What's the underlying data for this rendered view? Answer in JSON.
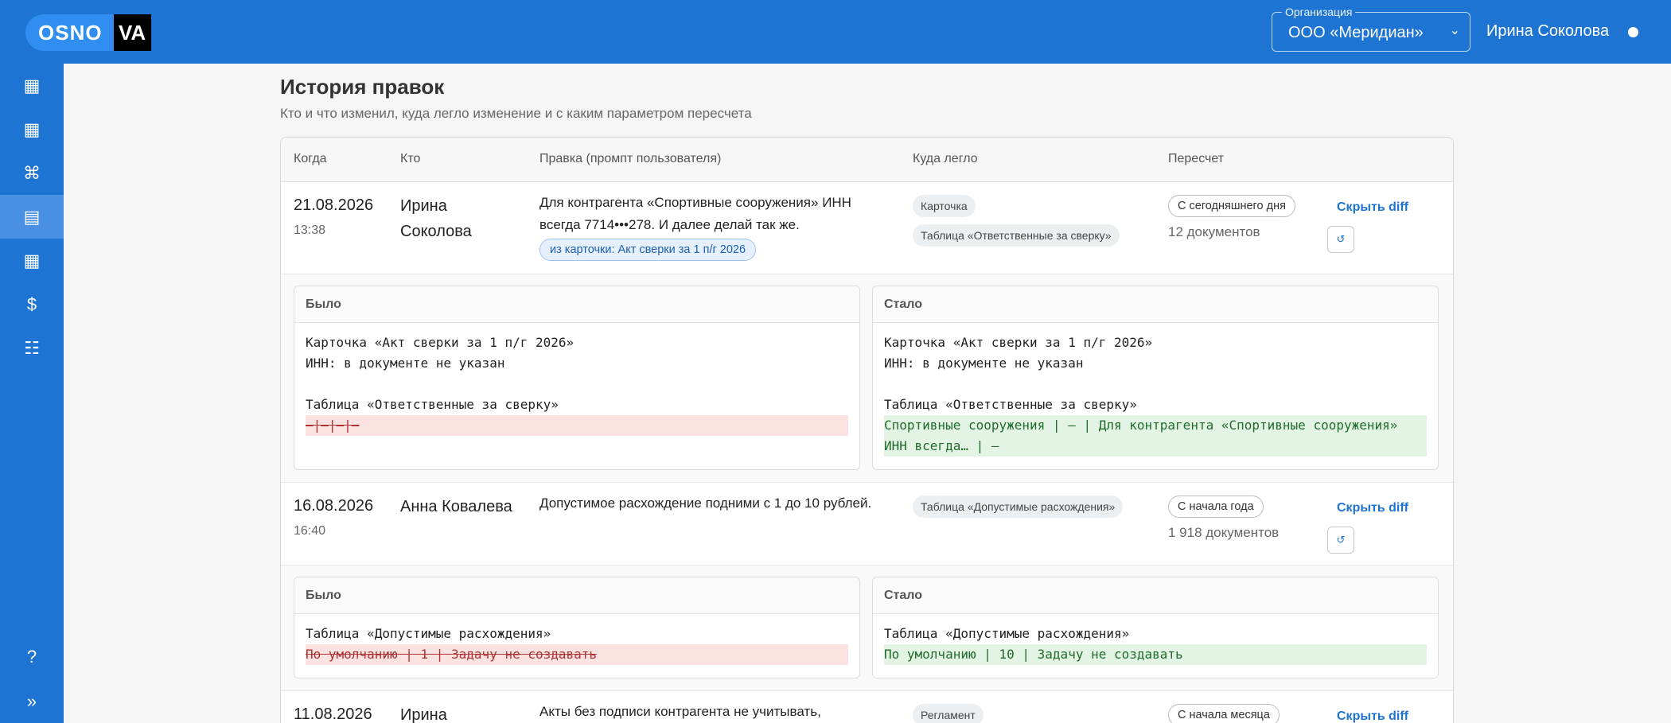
{
  "app": {
    "logo_left": "OSNO",
    "logo_right": "VA"
  },
  "header": {
    "org_label": "Организация",
    "org_value": "ООО «Меридиан»",
    "user_name": "Ирина Соколова"
  },
  "sidebar": {
    "items": [
      {
        "icon": "grid-icon",
        "glyph": "▦"
      },
      {
        "icon": "grid-icon",
        "glyph": "▦"
      },
      {
        "icon": "command-icon",
        "glyph": "⌘"
      },
      {
        "icon": "table-icon",
        "glyph": "▤"
      },
      {
        "icon": "grid-icon",
        "glyph": "▦"
      },
      {
        "icon": "dollar-icon",
        "glyph": "$"
      },
      {
        "icon": "list-icon",
        "glyph": "☷"
      }
    ],
    "help": "?",
    "expand": "»"
  },
  "page": {
    "title": "История правок",
    "subtitle": "Кто и что изменил, куда легло изменение и с каким параметром пересчета"
  },
  "table": {
    "headers": {
      "when": "Когда",
      "who": "Кто",
      "edit": "Правка (промпт пользователя)",
      "where": "Куда легло",
      "recalc": "Пересчет"
    },
    "rows": [
      {
        "date": "21.08.2026",
        "time": "13:38",
        "who": "Ирина Соколова",
        "edit": "Для контрагента «Спортивные сооружения» ИНН всегда 7714•••278. И далее делай так же.",
        "source": "из карточки: Акт сверки за 1 п/г 2026",
        "targets": [
          "Карточка",
          "Таблица «Ответственные за сверку»"
        ],
        "recalc": "С сегодняшнего дня",
        "docs": "12 документов",
        "toggle": "Скрыть diff",
        "recalc_btn": "↺",
        "was_label": "Было",
        "now_label": "Стало",
        "was_lines": [
          "Карточка «Акт сверки за 1 п/г 2026»",
          "ИНН: в документе не указан",
          "",
          "Таблица «Ответственные за сверку»"
        ],
        "was_del": "—|—|—|—",
        "now_lines": [
          "Карточка «Акт сверки за 1 п/г 2026»",
          "ИНН: в документе не указан",
          "",
          "Таблица «Ответственные за сверку»"
        ],
        "now_add": "Спортивные сооружения | — | Для контрагента «Спортивные сооружения» ИНН всегда… | —"
      },
      {
        "date": "16.08.2026",
        "time": "16:40",
        "who": "Анна Ковалева",
        "edit": "Допустимое расхождение подними с 1 до 10 рублей.",
        "targets": [
          "Таблица «Допустимые расхождения»"
        ],
        "recalc": "С начала года",
        "docs": "1 918 документов",
        "toggle": "Скрыть diff",
        "recalc_btn": "↺",
        "was_label": "Было",
        "now_label": "Стало",
        "was_lines": [
          "Таблица «Допустимые расхождения»"
        ],
        "was_del": "По умолчанию | 1 | Задачу не создавать",
        "now_lines": [
          "Таблица «Допустимые расхождения»"
        ],
        "now_add": "По умолчанию | 10 | Задачу не создавать"
      },
      {
        "date": "11.08.2026",
        "who": "Ирина",
        "edit": "Акты без подписи контрагента не учитывать,",
        "targets": [
          "Регламент"
        ],
        "recalc": "С начала месяца",
        "toggle": "Скрыть diff"
      }
    ]
  }
}
